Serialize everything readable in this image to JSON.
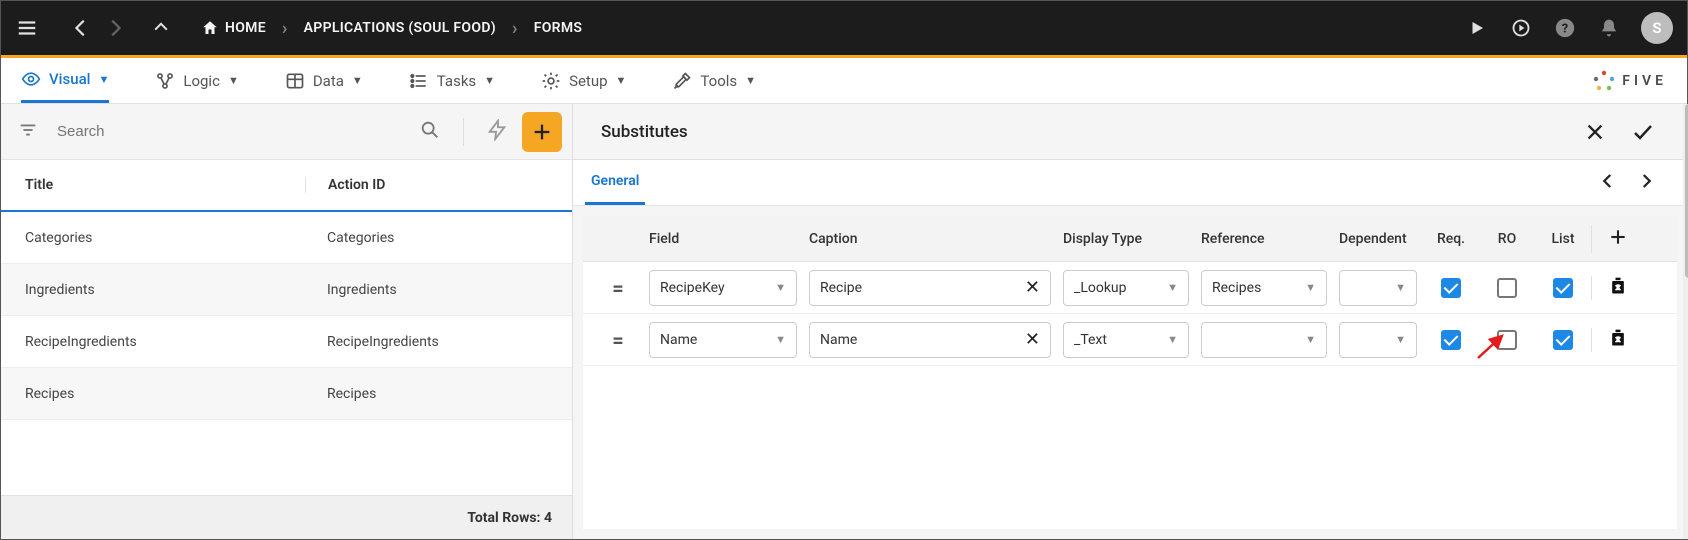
{
  "breadcrumb": {
    "home": "HOME",
    "apps": "APPLICATIONS (SOUL FOOD)",
    "forms": "FORMS"
  },
  "avatar_initial": "S",
  "tabs": {
    "visual": "Visual",
    "logic": "Logic",
    "data": "Data",
    "tasks": "Tasks",
    "setup": "Setup",
    "tools": "Tools"
  },
  "brand": "FIVE",
  "left": {
    "search_placeholder": "Search",
    "head_title": "Title",
    "head_action": "Action ID",
    "rows": [
      {
        "title": "Categories",
        "action": "Categories"
      },
      {
        "title": "Ingredients",
        "action": "Ingredients"
      },
      {
        "title": "RecipeIngredients",
        "action": "RecipeIngredients"
      },
      {
        "title": "Recipes",
        "action": "Recipes"
      }
    ],
    "footer": "Total Rows: 4"
  },
  "right": {
    "title": "Substitutes",
    "tab_general": "General",
    "columns": {
      "field": "Field",
      "caption": "Caption",
      "display_type": "Display Type",
      "reference": "Reference",
      "dependent": "Dependent",
      "req": "Req.",
      "ro": "RO",
      "list": "List"
    },
    "rows": [
      {
        "field": "RecipeKey",
        "caption": "Recipe",
        "display_type": "_Lookup",
        "reference": "Recipes",
        "dependent": "",
        "req": true,
        "ro": false,
        "list": true
      },
      {
        "field": "Name",
        "caption": "Name",
        "display_type": "_Text",
        "reference": "",
        "dependent": "",
        "req": true,
        "ro": false,
        "list": true
      }
    ]
  }
}
